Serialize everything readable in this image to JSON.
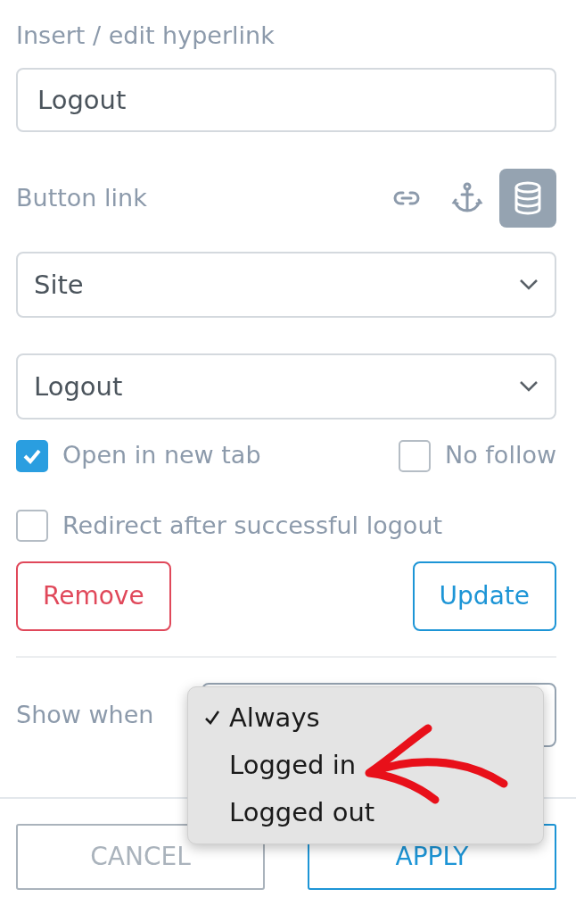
{
  "dialog": {
    "title": "Insert / edit hyperlink",
    "text_field": {
      "value": "Logout"
    },
    "link_section": {
      "label": "Button link",
      "link_types": [
        {
          "kind": "url",
          "selected": false
        },
        {
          "kind": "anchor",
          "selected": false
        },
        {
          "kind": "database",
          "selected": true
        }
      ]
    },
    "selects": [
      {
        "value": "Site"
      },
      {
        "value": "Logout"
      }
    ],
    "checkboxes": [
      {
        "label": "Open in new tab",
        "checked": true
      },
      {
        "label": "No follow",
        "checked": false
      },
      {
        "label": "Redirect after successful logout",
        "checked": false
      }
    ],
    "actions": [
      {
        "kind": "danger",
        "label": "Remove"
      },
      {
        "kind": "primary",
        "label": "Update"
      }
    ],
    "show_when": {
      "label": "Show when",
      "options": [
        {
          "label": "Always",
          "selected": true
        },
        {
          "label": "Logged in",
          "selected": false
        },
        {
          "label": "Logged out",
          "selected": false
        }
      ]
    },
    "footer": [
      {
        "kind": "secondary",
        "label": "CANCEL"
      },
      {
        "kind": "primary",
        "label": "APPLY"
      }
    ]
  }
}
